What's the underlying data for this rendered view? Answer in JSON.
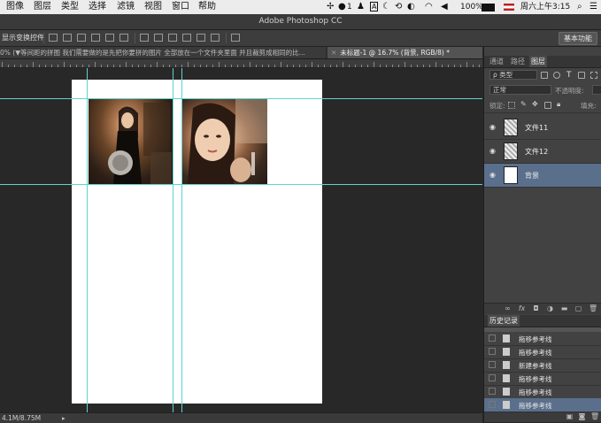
{
  "menubar": {
    "items": [
      "图像",
      "图层",
      "类型",
      "选择",
      "滤镜",
      "视图",
      "窗口",
      "帮助"
    ],
    "tray": {
      "wechat_badge": "1",
      "battery": "100%",
      "clock": "周六上午3:15"
    }
  },
  "app": {
    "title": "Adobe Photoshop CC"
  },
  "options": {
    "show_transform_label": "显示变换控件",
    "essentials_label": "基本功能"
  },
  "tabs": [
    {
      "label": "0% (▼等间距的拼图 我们需要做的是先把你要拼的图片 全部放在一个文件夹里面 并且裁剪成相同的比..."
    },
    {
      "label": "未标题-1 @ 16.7% (背景, RGB/8) *"
    }
  ],
  "status": {
    "doc_size": "4.1M/8.75M"
  },
  "layers_panel": {
    "tabs": [
      "通道",
      "路径",
      "图层"
    ],
    "kind_filter": "ρ 类型",
    "blend_mode": "正常",
    "opacity_label": "不透明度:",
    "lock_label": "锁定:",
    "fill_label": "填充:",
    "layers": [
      {
        "name": "文件11"
      },
      {
        "name": "文件12"
      },
      {
        "name": "背景"
      }
    ]
  },
  "history_panel": {
    "title": "历史记录",
    "items": [
      {
        "name": "拖移参考线"
      },
      {
        "name": "拖移参考线"
      },
      {
        "name": "新建参考线"
      },
      {
        "name": "拖移参考线"
      },
      {
        "name": "拖移参考线"
      },
      {
        "name": "拖移参考线"
      }
    ]
  },
  "colors": {
    "guide": "#5fd3d3",
    "selection": "#5a6f8c",
    "workspace": "#282828"
  }
}
